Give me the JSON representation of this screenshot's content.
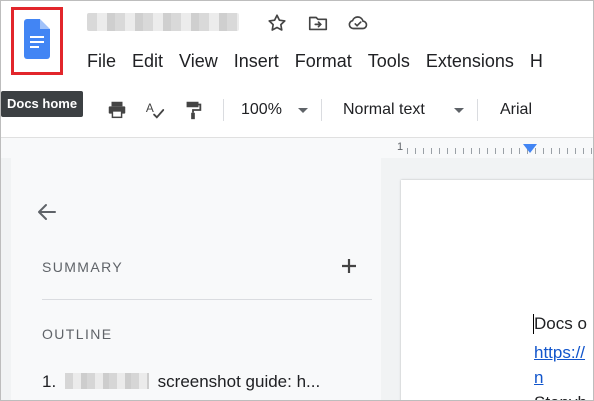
{
  "header": {
    "menu": [
      "File",
      "Edit",
      "View",
      "Insert",
      "Format",
      "Tools",
      "Extensions",
      "H"
    ]
  },
  "tooltip": {
    "text": "Docs home"
  },
  "toolbar": {
    "zoom": "100%",
    "style": "Normal text",
    "font": "Arial"
  },
  "ruler": {
    "number": "1"
  },
  "side_panel": {
    "summary_label": "SUMMARY",
    "outline_label": "OUTLINE",
    "outline_items": [
      {
        "number": "1.",
        "text": "screenshot guide: h..."
      }
    ]
  },
  "document": {
    "line1": "Docs o",
    "line2": "https://",
    "line3": "n",
    "line4": "Stepvh"
  },
  "colors": {
    "accent": "#4285f4",
    "highlight_border": "#e2262b",
    "link": "#1155cc"
  }
}
